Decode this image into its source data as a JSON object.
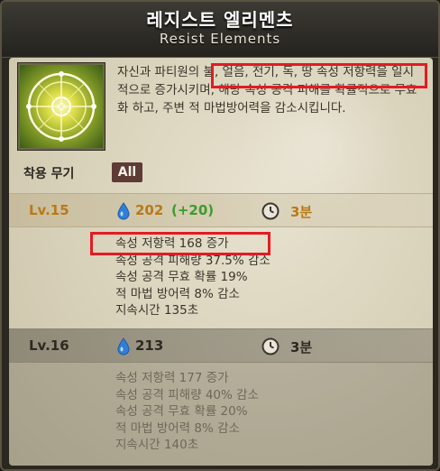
{
  "title": {
    "korean": "레지스트 엘리멘츠",
    "english": "Resist Elements"
  },
  "skill": {
    "icon": "elemental-seal-icon",
    "description": "자신과 파티원의 불, 얼음, 전기, 독, 땅 속성 저항력을 일시적으로 증가시키며, 해당 속성 공격 피해를 확률적으로 무효화 하고, 주변 적 마법방어력을 감소시킵니다."
  },
  "weapon": {
    "label": "착용 무기",
    "value": "All"
  },
  "levels": [
    {
      "level": "Lv.15",
      "mp": "202",
      "mp_bonus": "(+20)",
      "cooldown": "3분",
      "effects": [
        "속성 저항력 168 증가",
        "속성 공격 피해량 37.5% 감소",
        "속성 공격 무효 확률 19%",
        "적 마법 방어력 8% 감소",
        "지속시간 135초"
      ]
    },
    {
      "level": "Lv.16",
      "mp": "213",
      "cooldown": "3분",
      "effects": [
        "속성 저항력 177 증가",
        "속성 공격 피해량 40% 감소",
        "속성 공격 무효 확률 20%",
        "적 마법 방어력 8% 감소",
        "지속시간 140초"
      ]
    }
  ],
  "colors": {
    "current_level": "#b97a14",
    "bonus": "#3b9c2a",
    "highlight": "#e31b23",
    "badge": "#5e3b34"
  }
}
